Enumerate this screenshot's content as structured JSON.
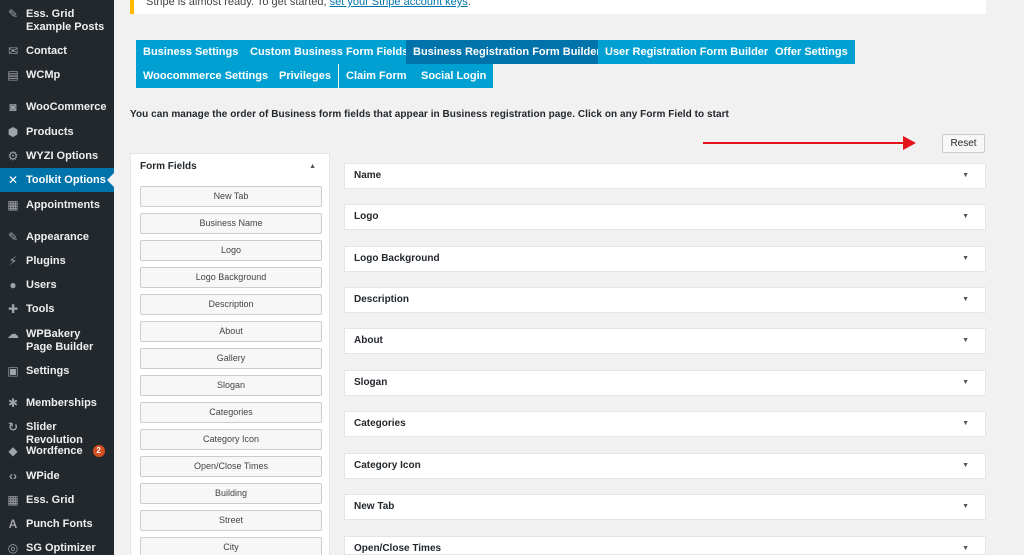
{
  "sidebar": {
    "items": [
      {
        "label": "Ess. Grid Example Posts",
        "icon": "pin-icon",
        "glyph": "✎"
      },
      {
        "label": "Contact",
        "icon": "mail-icon",
        "glyph": "✉"
      },
      {
        "label": "WCMp",
        "icon": "wcmp-icon",
        "glyph": "▤"
      },
      {
        "label": "WooCommerce",
        "icon": "woocommerce-icon",
        "glyph": "◙"
      },
      {
        "label": "Products",
        "icon": "products-icon",
        "glyph": "⬢"
      },
      {
        "label": "WYZI Options",
        "icon": "options-icon",
        "glyph": "⚙"
      },
      {
        "label": "Toolkit Options",
        "icon": "toolkit-icon",
        "glyph": "✕"
      },
      {
        "label": "Appointments",
        "icon": "calendar-icon",
        "glyph": "▦"
      },
      {
        "label": "Appearance",
        "icon": "brush-icon",
        "glyph": "✎"
      },
      {
        "label": "Plugins",
        "icon": "plugin-icon",
        "glyph": "⚡"
      },
      {
        "label": "Users",
        "icon": "user-icon",
        "glyph": "●"
      },
      {
        "label": "Tools",
        "icon": "wrench-icon",
        "glyph": "✚"
      },
      {
        "label": "WPBakery Page Builder",
        "icon": "wpbakery-icon",
        "glyph": "☁"
      },
      {
        "label": "Settings",
        "icon": "settings-icon",
        "glyph": "▣"
      },
      {
        "label": "Memberships",
        "icon": "memberships-icon",
        "glyph": "✱"
      },
      {
        "label": "Slider Revolution",
        "icon": "slider-icon",
        "glyph": "↻"
      },
      {
        "label": "Wordfence",
        "icon": "wordfence-icon",
        "glyph": "◆",
        "badge": "2"
      },
      {
        "label": "WPide",
        "icon": "code-icon",
        "glyph": "‹›"
      },
      {
        "label": "Ess. Grid",
        "icon": "grid-icon",
        "glyph": "▦"
      },
      {
        "label": "Punch Fonts",
        "icon": "font-icon",
        "glyph": "A"
      },
      {
        "label": "SG Optimizer",
        "icon": "optimizer-icon",
        "glyph": "◎"
      }
    ]
  },
  "notice": {
    "text": "Stripe is almost ready. To get started, ",
    "link": "set your Stripe account keys",
    "end": "."
  },
  "tabs": [
    {
      "label": "Business Settings"
    },
    {
      "label": "Custom Business Form Fields"
    },
    {
      "label": "Business Registration Form Builder"
    },
    {
      "label": "User Registration Form Builder"
    },
    {
      "label": "Offer Settings"
    },
    {
      "label": "Woocommerce Settings"
    },
    {
      "label": "Privileges"
    },
    {
      "label": "Claim Form"
    },
    {
      "label": "Social Login"
    }
  ],
  "intro": "You can manage the order of Business form fields that appear in Business registration page. Click on any Form Field to start",
  "reset_label": "Reset",
  "form_fields": {
    "title": "Form Fields",
    "toggle": "▲",
    "buttons": [
      "New Tab",
      "Business Name",
      "Logo",
      "Logo Background",
      "Description",
      "About",
      "Gallery",
      "Slogan",
      "Categories",
      "Category Icon",
      "Open/Close Times",
      "Building",
      "Street",
      "City"
    ]
  },
  "field_list": {
    "arrow": "▼",
    "items": [
      "Name",
      "Logo",
      "Logo Background",
      "Description",
      "About",
      "Slogan",
      "Categories",
      "Category Icon",
      "New Tab",
      "Open/Close Times"
    ]
  },
  "colors": {
    "tab": "#00a0d2",
    "tab_active": "#0073aa",
    "sidebar_bg": "#23282d",
    "annotation_arrow": "#e3141a"
  }
}
